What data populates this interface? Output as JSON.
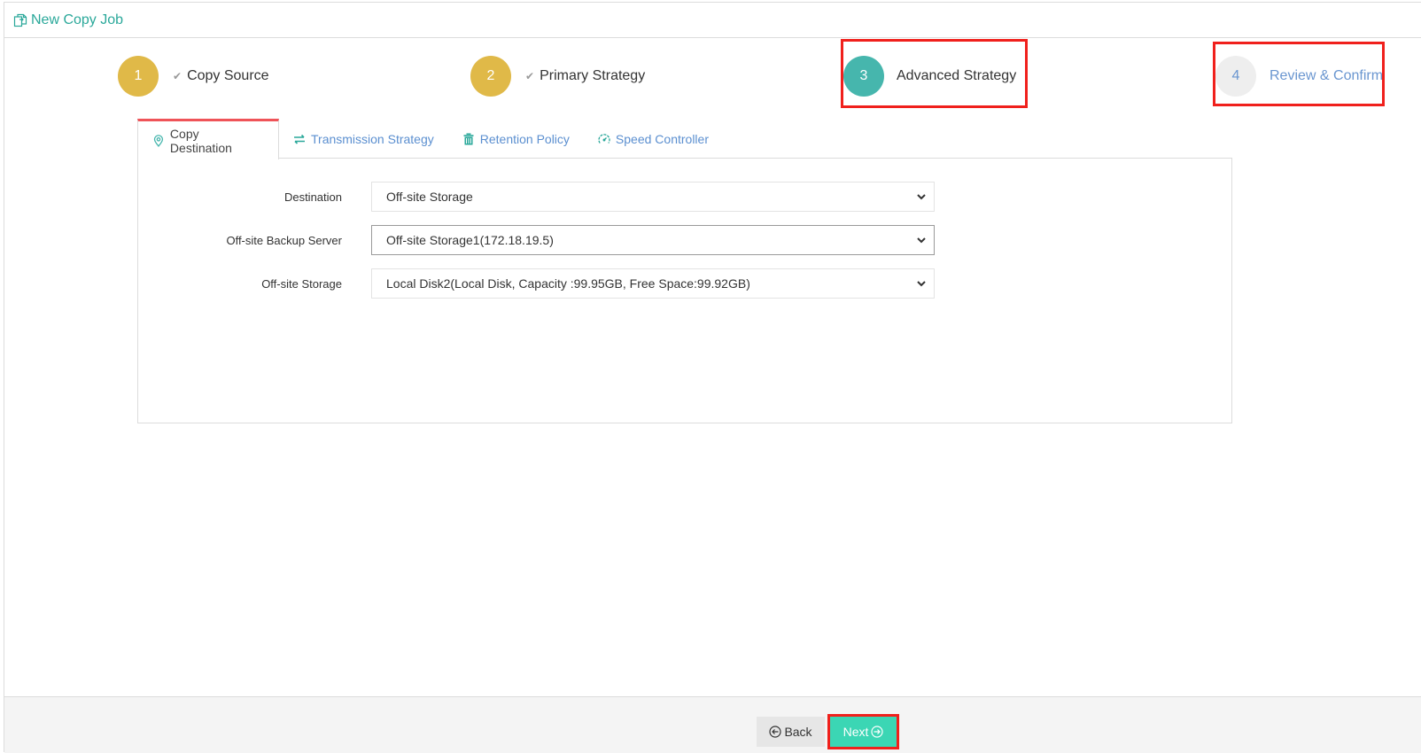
{
  "header": {
    "title": "New Copy Job",
    "icon": "copy-job-icon"
  },
  "steps": [
    {
      "number": "1",
      "label": "Copy Source",
      "status": "done"
    },
    {
      "number": "2",
      "label": "Primary Strategy",
      "status": "done"
    },
    {
      "number": "3",
      "label": "Advanced Strategy",
      "status": "active"
    },
    {
      "number": "4",
      "label": "Review & Confirm",
      "status": "pending"
    }
  ],
  "tabs": [
    {
      "label": "Copy Destination",
      "icon": "location-pin-icon",
      "active": true
    },
    {
      "label": "Transmission Strategy",
      "icon": "transfer-arrows-icon",
      "active": false
    },
    {
      "label": "Retention Policy",
      "icon": "trash-icon",
      "active": false
    },
    {
      "label": "Speed Controller",
      "icon": "speedometer-icon",
      "active": false
    }
  ],
  "form": {
    "fields": [
      {
        "label": "Destination",
        "value": "Off-site Storage"
      },
      {
        "label": "Off-site Backup Server",
        "value": "Off-site Storage1(172.18.19.5)"
      },
      {
        "label": "Off-site Storage",
        "value": "Local Disk2(Local Disk, Capacity :99.95GB, Free Space:99.92GB)"
      }
    ]
  },
  "footer": {
    "back_label": "Back",
    "next_label": "Next"
  },
  "colors": {
    "accent": "#2aa89a",
    "step_done": "#e0b948",
    "step_active": "#46b6ad",
    "step_pending": "#eeeeee",
    "tab_active_border": "#ef5358",
    "next_button": "#3bd6b4",
    "highlight": "#f0201c"
  }
}
